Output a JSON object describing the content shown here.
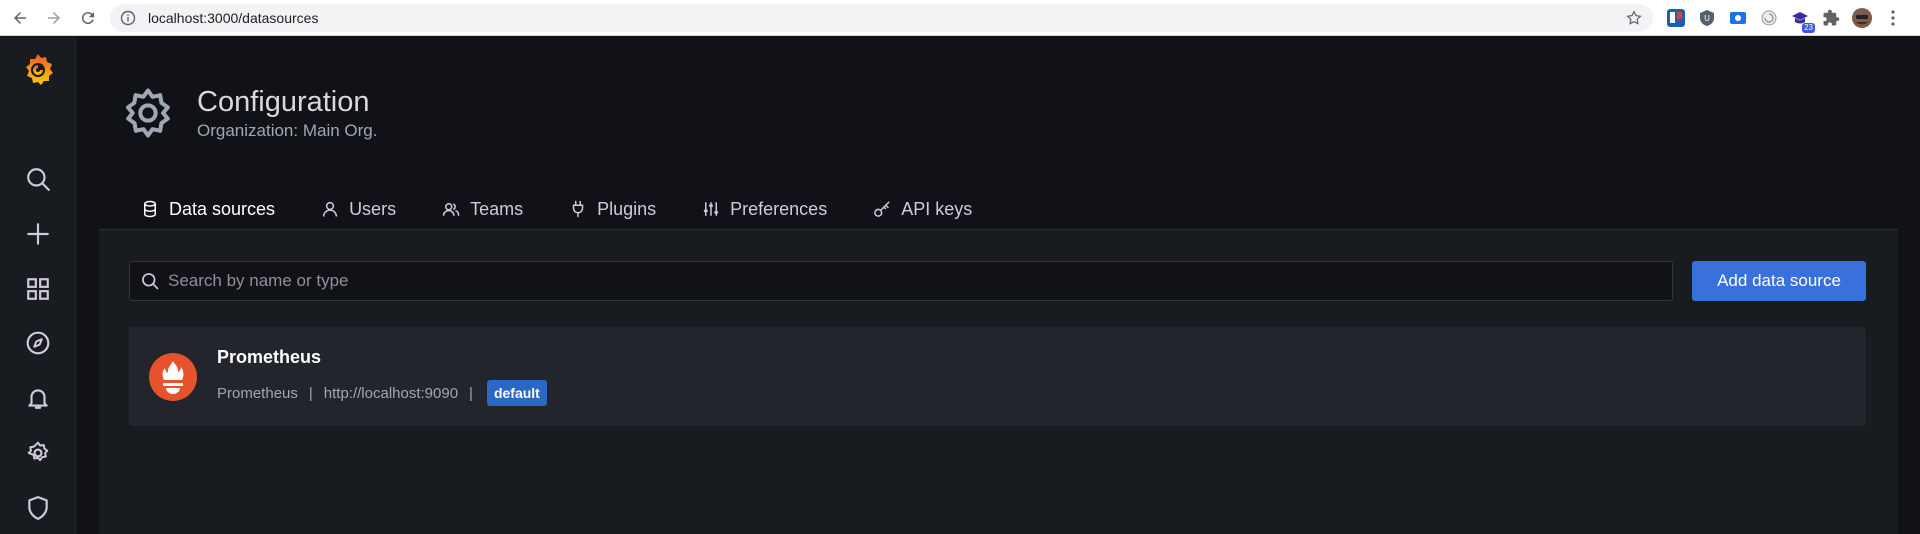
{
  "browser": {
    "url": "localhost:3000/datasources",
    "extensions": [
      "trello-icon",
      "shield-ext-icon",
      "screen-capture-icon",
      "snail-icon",
      "graduation-cap-icon",
      "puzzle-icon",
      "avatar-icon"
    ],
    "extension_badge": "23"
  },
  "sidebar": {
    "items": [
      "search-icon",
      "plus-icon",
      "apps-icon",
      "compass-icon",
      "bell-icon",
      "gear-icon",
      "shield-icon"
    ]
  },
  "header": {
    "title": "Configuration",
    "subtitle": "Organization: Main Org."
  },
  "tabs": [
    {
      "label": "Data sources",
      "icon": "database-icon",
      "active": true
    },
    {
      "label": "Users",
      "icon": "user-icon",
      "active": false
    },
    {
      "label": "Teams",
      "icon": "users-icon",
      "active": false
    },
    {
      "label": "Plugins",
      "icon": "plug-icon",
      "active": false
    },
    {
      "label": "Preferences",
      "icon": "sliders-icon",
      "active": false
    },
    {
      "label": "API keys",
      "icon": "key-icon",
      "active": false
    }
  ],
  "search": {
    "placeholder": "Search by name or type",
    "value": ""
  },
  "add_button_label": "Add data source",
  "datasources": [
    {
      "name": "Prometheus",
      "type": "Prometheus",
      "url": "http://localhost:9090",
      "separator": "|",
      "badge": "default"
    }
  ],
  "colors": {
    "accent_primary": "#3871dc",
    "prometheus_red": "#e6522c",
    "badge_blue": "#2b67c4"
  }
}
